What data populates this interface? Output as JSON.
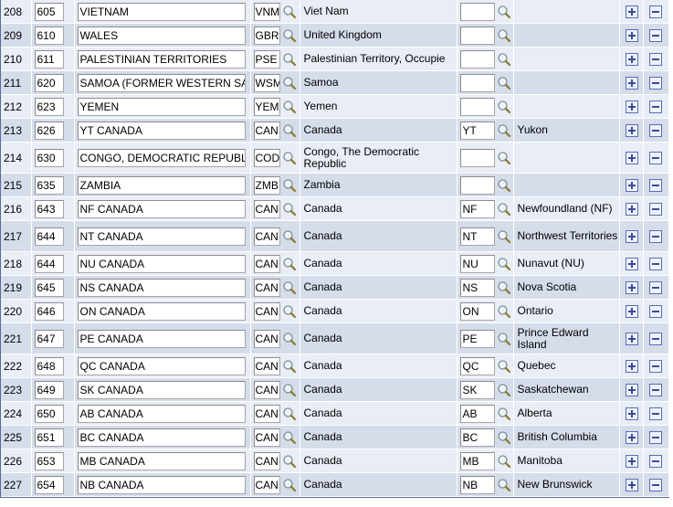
{
  "icons": {
    "search": "search-icon",
    "add": "add-row-icon",
    "delete": "delete-row-icon"
  },
  "rows": [
    {
      "num": "208",
      "code": "605",
      "desc": "VIETNAM",
      "country": "VNM",
      "country_name": "Viet Nam",
      "state": "",
      "state_name": "",
      "tall": false
    },
    {
      "num": "209",
      "code": "610",
      "desc": "WALES",
      "country": "GBR",
      "country_name": "United Kingdom",
      "state": "",
      "state_name": "",
      "tall": false
    },
    {
      "num": "210",
      "code": "611",
      "desc": "PALESTINIAN TERRITORIES",
      "country": "PSE",
      "country_name": "Palestinian Territory, Occupie",
      "state": "",
      "state_name": "",
      "tall": false
    },
    {
      "num": "211",
      "code": "620",
      "desc": "SAMOA (FORMER WESTERN SAMOA",
      "country": "WSM",
      "country_name": "Samoa",
      "state": "",
      "state_name": "",
      "tall": false
    },
    {
      "num": "212",
      "code": "623",
      "desc": "YEMEN",
      "country": "YEM",
      "country_name": "Yemen",
      "state": "",
      "state_name": "",
      "tall": false
    },
    {
      "num": "213",
      "code": "626",
      "desc": "YT CANADA",
      "country": "CAN",
      "country_name": "Canada",
      "state": "YT",
      "state_name": "Yukon",
      "tall": false
    },
    {
      "num": "214",
      "code": "630",
      "desc": "CONGO, DEMOCRATIC REPUBLIC",
      "country": "COD",
      "country_name": "Congo, The Democratic Republic",
      "state": "",
      "state_name": "",
      "tall": true
    },
    {
      "num": "215",
      "code": "635",
      "desc": "ZAMBIA",
      "country": "ZMB",
      "country_name": "Zambia",
      "state": "",
      "state_name": "",
      "tall": false
    },
    {
      "num": "216",
      "code": "643",
      "desc": "NF CANADA",
      "country": "CAN",
      "country_name": "Canada",
      "state": "NF",
      "state_name": "Newfoundland (NF)",
      "tall": false
    },
    {
      "num": "217",
      "code": "644",
      "desc": "NT CANADA",
      "country": "CAN",
      "country_name": "Canada",
      "state": "NT",
      "state_name": "Northwest Territories",
      "tall": true
    },
    {
      "num": "218",
      "code": "644",
      "desc": "NU CANADA",
      "country": "CAN",
      "country_name": "Canada",
      "state": "NU",
      "state_name": "Nunavut (NU)",
      "tall": false
    },
    {
      "num": "219",
      "code": "645",
      "desc": "NS CANADA",
      "country": "CAN",
      "country_name": "Canada",
      "state": "NS",
      "state_name": "Nova Scotia",
      "tall": false
    },
    {
      "num": "220",
      "code": "646",
      "desc": "ON CANADA",
      "country": "CAN",
      "country_name": "Canada",
      "state": "ON",
      "state_name": "Ontario",
      "tall": false
    },
    {
      "num": "221",
      "code": "647",
      "desc": "PE CANADA",
      "country": "CAN",
      "country_name": "Canada",
      "state": "PE",
      "state_name": "Prince Edward Island",
      "tall": true
    },
    {
      "num": "222",
      "code": "648",
      "desc": "QC CANADA",
      "country": "CAN",
      "country_name": "Canada",
      "state": "QC",
      "state_name": "Quebec",
      "tall": false
    },
    {
      "num": "223",
      "code": "649",
      "desc": "SK CANADA",
      "country": "CAN",
      "country_name": "Canada",
      "state": "SK",
      "state_name": "Saskatchewan",
      "tall": false
    },
    {
      "num": "224",
      "code": "650",
      "desc": "AB CANADA",
      "country": "CAN",
      "country_name": "Canada",
      "state": "AB",
      "state_name": "Alberta",
      "tall": false
    },
    {
      "num": "225",
      "code": "651",
      "desc": "BC CANADA",
      "country": "CAN",
      "country_name": "Canada",
      "state": "BC",
      "state_name": "British Columbia",
      "tall": false
    },
    {
      "num": "226",
      "code": "653",
      "desc": "MB CANADA",
      "country": "CAN",
      "country_name": "Canada",
      "state": "MB",
      "state_name": "Manitoba",
      "tall": false
    },
    {
      "num": "227",
      "code": "654",
      "desc": "NB CANADA",
      "country": "CAN",
      "country_name": "Canada",
      "state": "NB",
      "state_name": "New Brunswick",
      "tall": false
    }
  ]
}
